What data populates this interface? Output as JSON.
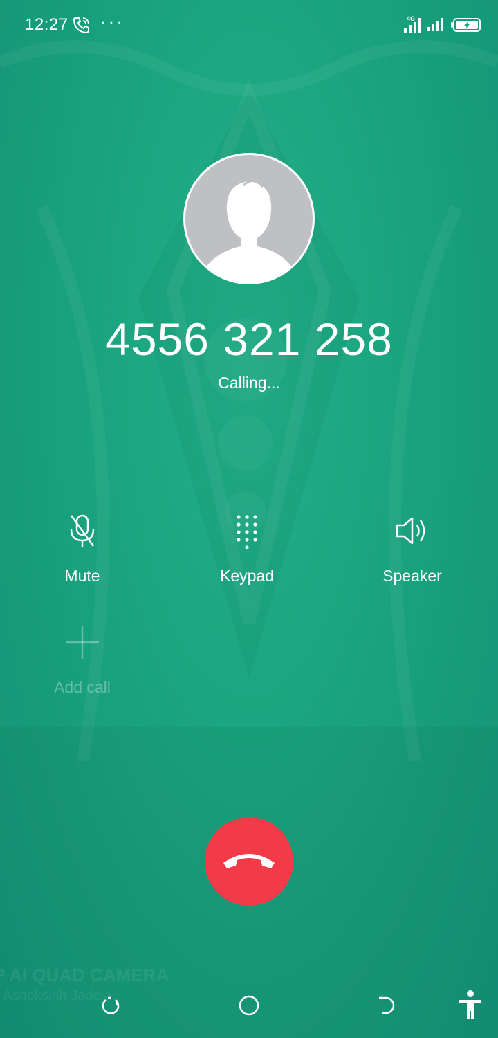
{
  "status_bar": {
    "time": "12:27",
    "call_icon": "phone-in-call-icon",
    "more_dots": "···",
    "network_badge": "4G",
    "battery_state": "charging",
    "accent": "#ffffff"
  },
  "contact": {
    "avatar_icon": "default-person-avatar",
    "phone_number": "4556 321 258",
    "call_status": "Calling..."
  },
  "controls": [
    {
      "id": "mute",
      "label": "Mute",
      "icon": "microphone-off-icon",
      "enabled": true
    },
    {
      "id": "keypad",
      "label": "Keypad",
      "icon": "dialpad-icon",
      "enabled": true
    },
    {
      "id": "speaker",
      "label": "Speaker",
      "icon": "speaker-icon",
      "enabled": true
    },
    {
      "id": "add_call",
      "label": "Add call",
      "icon": "plus-icon",
      "enabled": false
    }
  ],
  "end_call": {
    "icon": "hang-up-icon",
    "color": "#f23a48"
  },
  "watermark": {
    "line1": "P AI QUAD CAMERA",
    "line2": "y Ashoksinh Jadeja"
  },
  "nav_bar": {
    "buttons": [
      "recents",
      "home",
      "back",
      "accessibility"
    ]
  },
  "theme": {
    "background": "#1aa37e"
  }
}
